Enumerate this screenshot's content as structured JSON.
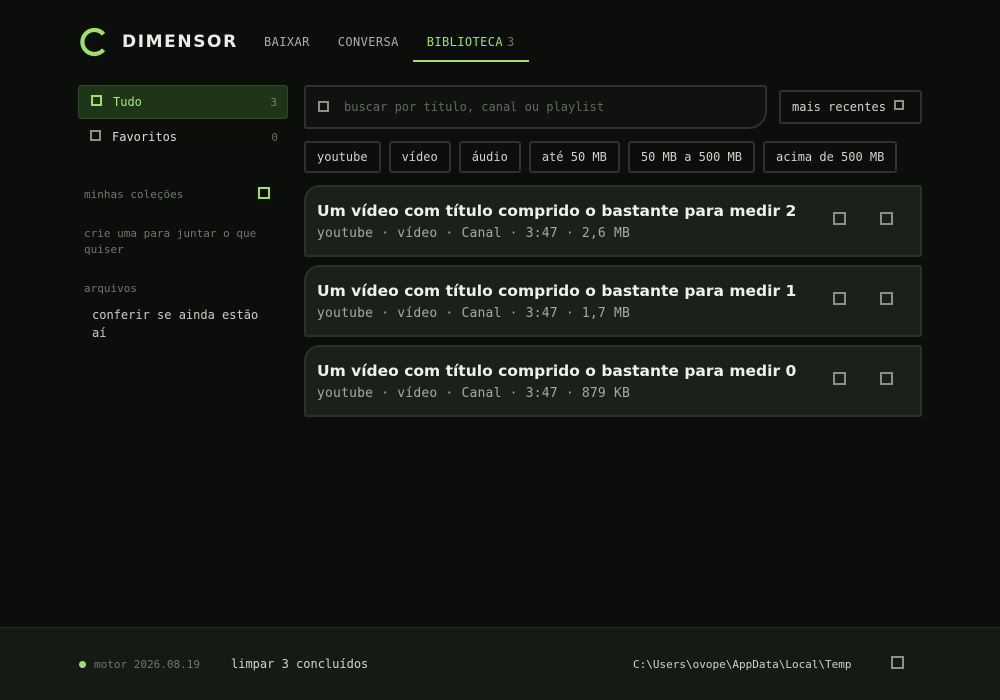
{
  "app": {
    "name": "DIMENSOR",
    "accent": "#9ee06a"
  },
  "nav": {
    "tabs": [
      {
        "label": "BAIXAR",
        "active": false
      },
      {
        "label": "CONVERSA",
        "active": false
      },
      {
        "label": "BIBLIOTECA",
        "count": "3",
        "active": true
      }
    ]
  },
  "sidebar": {
    "items": [
      {
        "label": "Tudo",
        "count": "3",
        "active": true
      },
      {
        "label": "Favoritos",
        "count": "0",
        "active": false
      }
    ],
    "collections_title": "minhas coleções",
    "collections_hint": "crie uma para juntar o que quiser",
    "files_title": "arquivos",
    "files_link": "conferir se ainda estão aí"
  },
  "search": {
    "placeholder": "buscar por título, canal ou playlist",
    "value": ""
  },
  "sort": {
    "label": "mais recentes"
  },
  "filters": [
    "youtube",
    "vídeo",
    "áudio",
    "até 50 MB",
    "50 MB a 500 MB",
    "acima de 500 MB"
  ],
  "videos": [
    {
      "title": "Um vídeo com título comprido o bastante para medir 2",
      "meta": "youtube · vídeo · Canal · 3:47 · 2,6 MB"
    },
    {
      "title": "Um vídeo com título comprido o bastante para medir 1",
      "meta": "youtube · vídeo · Canal · 3:47 · 1,7 MB"
    },
    {
      "title": "Um vídeo com título comprido o bastante para medir 0",
      "meta": "youtube · vídeo · Canal · 3:47 · 879 KB"
    }
  ],
  "footer": {
    "engine": "motor 2026.08.19",
    "clear_label": "limpar 3 concluídos",
    "path": "C:\\Users\\ovope\\AppData\\Local\\Temp"
  }
}
